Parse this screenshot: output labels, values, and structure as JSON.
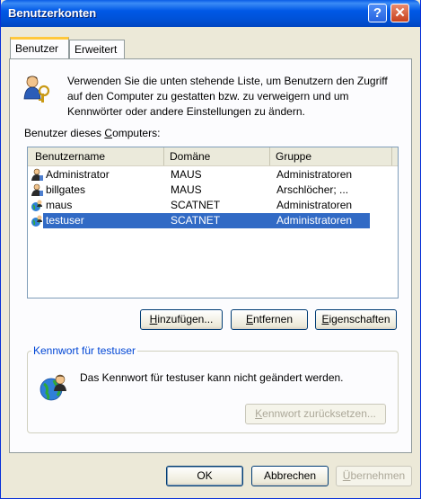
{
  "window": {
    "title": "Benutzerkonten"
  },
  "titlebar": {
    "help_glyph": "?",
    "close_glyph": "✕"
  },
  "tabs": [
    {
      "label": "Benutzer",
      "active": true
    },
    {
      "label": "Erweitert",
      "active": false
    }
  ],
  "intro": {
    "text": "Verwenden Sie die unten stehende Liste, um Benutzern den Zugriff auf den Computer zu gestatten bzw. zu verweigern und um Kennwörter oder andere Einstellungen zu ändern.",
    "icon": "users-key-icon"
  },
  "users_section": {
    "label_pre": "Benutzer dieses ",
    "label_accel": "C",
    "label_post": "omputers:"
  },
  "list": {
    "columns": [
      "Benutzername",
      "Domäne",
      "Gruppe"
    ],
    "rows": [
      {
        "name": "Administrator",
        "domain": "MAUS",
        "group": "Administratoren",
        "selected": false
      },
      {
        "name": "billgates",
        "domain": "MAUS",
        "group": "Arschlöcher; ...",
        "selected": false
      },
      {
        "name": "maus",
        "domain": "SCATNET",
        "group": "Administratoren",
        "selected": false
      },
      {
        "name": "testuser",
        "domain": "SCATNET",
        "group": "Administratoren",
        "selected": true
      }
    ]
  },
  "buttons": {
    "add": {
      "accel": "H",
      "rest": "inzufügen..."
    },
    "remove": {
      "accel": "E",
      "rest": "ntfernen"
    },
    "properties": {
      "accel": "E",
      "rest": "igenschaften"
    }
  },
  "password_group": {
    "title": "Kennwort für testuser",
    "text": "Das Kennwort für testuser kann nicht geändert werden.",
    "reset": {
      "accel": "K",
      "rest": "ennwort zurücksetzen..."
    },
    "icon": "globe-user-icon"
  },
  "footer": {
    "ok": "OK",
    "cancel": "Abbrechen",
    "apply": {
      "accel": "Ü",
      "rest": "bernehmen"
    }
  },
  "colors": {
    "accent": "#316ac5",
    "titlebar": "#0058e6",
    "group_title": "#0046d5"
  }
}
